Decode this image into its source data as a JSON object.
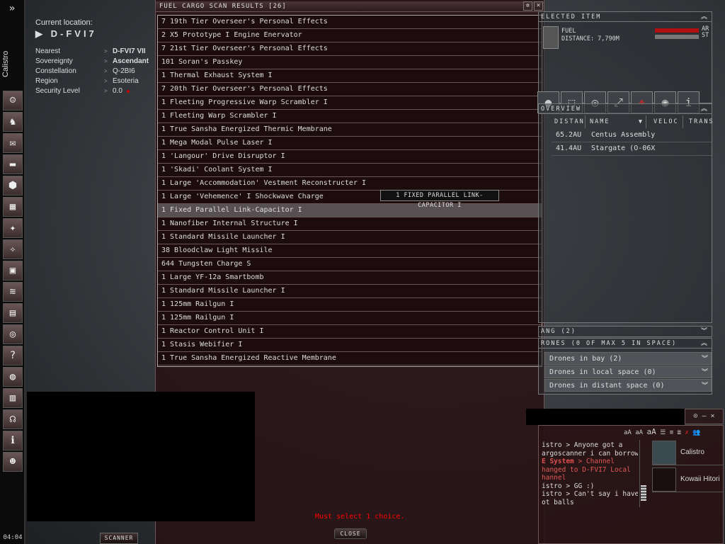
{
  "sidebar": {
    "character": "Calistro",
    "clock": "04:04",
    "toggle_icon": "»",
    "icons": [
      "character-sheet-icon",
      "people-icon",
      "mail-icon",
      "notepad-icon",
      "corporation-icon",
      "map-icon",
      "starmap-icon",
      "assets-icon",
      "wallet-icon",
      "scanner-icon",
      "calculator-icon",
      "help-lifebuoy-icon",
      "people-places-icon",
      "market-icon",
      "journal-icon",
      "chat-headset-icon",
      "help-info-icon",
      "ship-fitting-icon"
    ]
  },
  "location": {
    "label": "Current location:",
    "system": "D-FVI7",
    "rows": [
      {
        "k": "Nearest",
        "v": "D-FVI7 VII"
      },
      {
        "k": "Sovereignty",
        "v": "Ascendant"
      },
      {
        "k": "Constellation",
        "v": "Q-2BI6"
      },
      {
        "k": "Region",
        "v": "Esoteria"
      },
      {
        "k": "Security Level",
        "v": "0.0"
      }
    ]
  },
  "scan": {
    "title": "FUEL CARGO SCAN RESULTS [26]",
    "items": [
      "7 19th Tier Overseer's Personal Effects",
      "2 X5 Prototype I Engine Enervator",
      "7 21st Tier Overseer's Personal Effects",
      "101 Soran's Passkey",
      "1 Thermal Exhaust System I",
      "7 20th Tier Overseer's Personal Effects",
      "1 Fleeting Progressive Warp Scrambler I",
      "1 Fleeting Warp Scrambler I",
      "1 True Sansha Energized Thermic Membrane",
      "1 Mega Modal Pulse Laser I",
      "1 'Langour' Drive Disruptor I",
      "1 'Skadi' Coolant System I",
      "1 Large 'Accommodation' Vestment Reconstructer I",
      "1 Large 'Vehemence' I Shockwave Charge",
      "1 Fixed Parallel Link-Capacitor I",
      "1 Nanofiber Internal Structure I",
      "1 Standard Missile Launcher I",
      "38 Bloodclaw Light Missile",
      "644 Tungsten Charge S",
      "1 Large YF-12a Smartbomb",
      "1 Standard Missile Launcher I",
      "1 125mm Railgun I",
      "1 125mm Railgun I",
      "1 Reactor Control Unit I",
      "1 Stasis Webifier I",
      "1 True Sansha Energized Reactive Membrane"
    ],
    "selected_index": 14,
    "tooltip": "1 FIXED PARALLEL LINK-CAPACITOR I",
    "error": "Must select 1 choice.",
    "close_label": "CLOSE"
  },
  "scanner_label": "SCANNER",
  "selected_item": {
    "title": "ELECTED ITEM",
    "name": "FUEL",
    "distance": "DISTANCE: 7,790M",
    "armor_label": "AR",
    "structure_label": "ST",
    "armor_color": "#b01010",
    "structure_color": "#777777",
    "actions": [
      "approach-icon",
      "warp-icon",
      "orbit-icon",
      "keep-at-range-icon",
      "lock-target-icon",
      "look-at-icon",
      "show-info-icon"
    ],
    "action_glyphs": [
      "●",
      "⬚",
      "◎",
      "⤢",
      "⌖",
      "◉",
      "i"
    ]
  },
  "overview": {
    "title": "OVERVIEW",
    "columns": [
      "DISTAN",
      "NAME",
      "VELOC",
      "TRANS"
    ],
    "rows": [
      {
        "distance": "65.2AU",
        "name": "Centus Assembly"
      },
      {
        "distance": "41.4AU",
        "name": "Stargate (O-06X"
      }
    ]
  },
  "gang": {
    "title": "ANG (2)"
  },
  "drones": {
    "title": "RONES (0 OF MAX 5 IN SPACE)",
    "rows": [
      "Drones in bay (2)",
      "Drones in local space (0)",
      "Drones in distant space (0)"
    ]
  },
  "chat": {
    "font_sizes": [
      "aA",
      "aA",
      "aA"
    ],
    "messages": [
      {
        "speaker": "istro",
        "text": " > Anyone got a"
      },
      {
        "speaker": "",
        "text": "argoscanner i can borrow?"
      },
      {
        "speaker": "E System",
        "text": " > Channel",
        "system": true
      },
      {
        "speaker": "",
        "text": "hanged to D-FVI7 Local",
        "system": true
      },
      {
        "speaker": "",
        "text": "hannel",
        "system": true
      },
      {
        "speaker": "istro",
        "text": " > GG :)"
      },
      {
        "speaker": "istro",
        "text": " > Can't say i haven't"
      },
      {
        "speaker": "",
        "text": "ot balls"
      }
    ],
    "members": [
      "Calistro",
      "Kowaii Hitori"
    ]
  }
}
